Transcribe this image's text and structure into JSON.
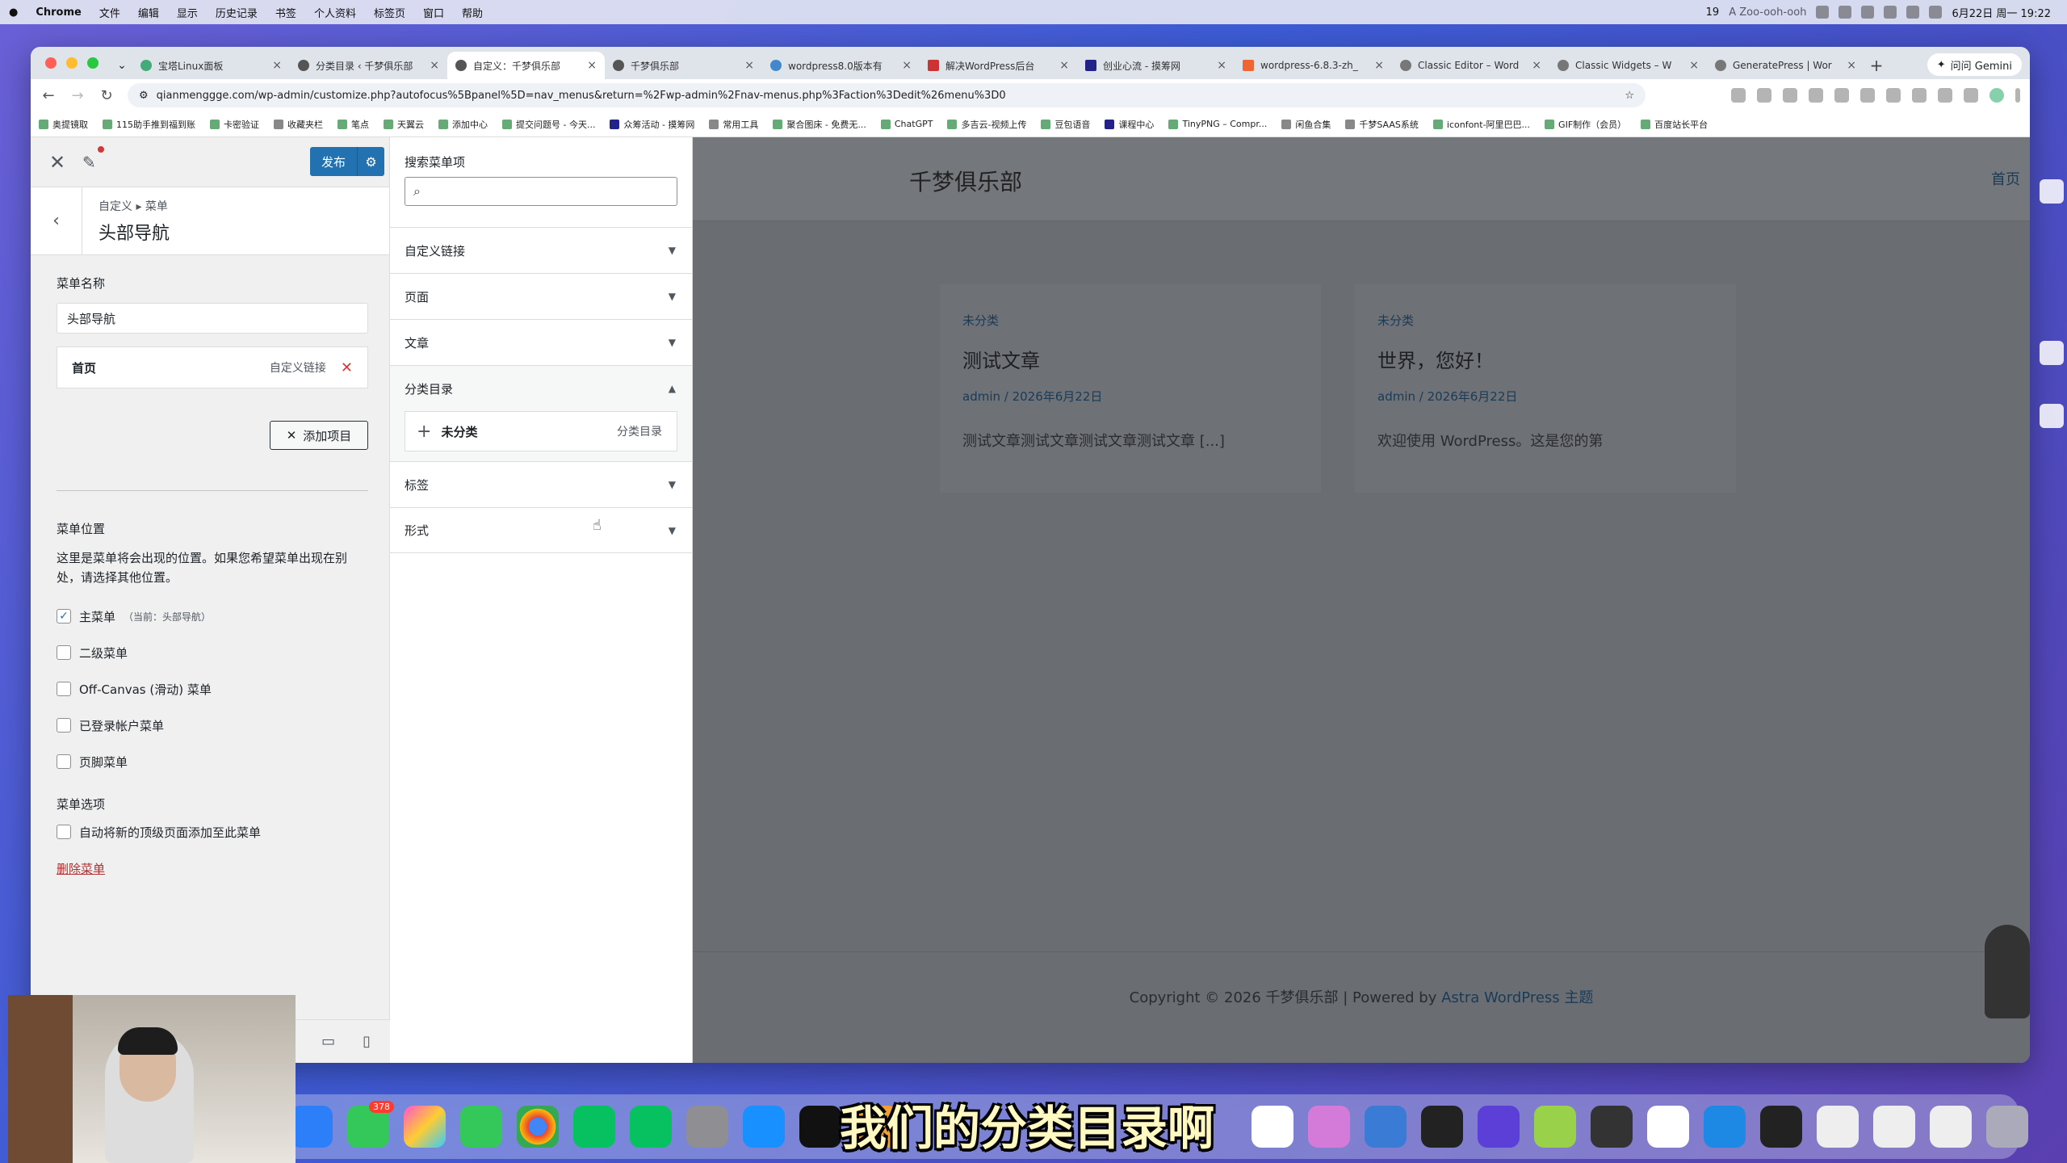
{
  "menubar": {
    "app": "Chrome",
    "items": [
      "文件",
      "编辑",
      "显示",
      "历史记录",
      "书签",
      "个人资料",
      "标签页",
      "窗口",
      "帮助"
    ],
    "status_text": "A Zoo-ooh-ooh",
    "badge_count": "19",
    "clock": "6月22日 周一 19:22"
  },
  "tabs": [
    {
      "title": "宝塔Linux面板"
    },
    {
      "title": "分类目录 ‹ 千梦俱乐部"
    },
    {
      "title": "自定义：千梦俱乐部"
    },
    {
      "title": "千梦俱乐部"
    },
    {
      "title": "wordpress8.0版本有"
    },
    {
      "title": "解决WordPress后台"
    },
    {
      "title": "创业心流 - 摸筹网"
    },
    {
      "title": "wordpress-6.8.3-zh_"
    },
    {
      "title": "Classic Editor – Word"
    },
    {
      "title": "Classic Widgets – W"
    },
    {
      "title": "GeneratePress | Wor"
    }
  ],
  "gemini_label": "问问 Gemini",
  "url": "qianmenggge.com/wp-admin/customize.php?autofocus%5Bpanel%5D=nav_menus&return=%2Fwp-admin%2Fnav-menus.php%3Faction%3Dedit%26menu%3D0",
  "bookmarks": [
    "奥提镜取",
    "115助手推到福到账",
    "卡密验证",
    "收藏夹栏",
    "笔点",
    "天翼云",
    "添加中心",
    "提交问题号 - 今天...",
    "众筹活动 - 摸筹网",
    "常用工具",
    "聚合图床 - 免费无...",
    "ChatGPT",
    "多吉云-视频上传",
    "豆包语音",
    "课程中心",
    "TinyPNG – Compr...",
    "闲鱼合集",
    "千梦SAAS系统",
    "iconfont-阿里巴巴...",
    "GIF制作（会员）",
    "百度站长平台"
  ],
  "customizer": {
    "publish_label": "发布",
    "breadcrumb": "自定义 ▸ 菜单",
    "section_title": "头部导航",
    "menu_name_label": "菜单名称",
    "menu_name_value": "头部导航",
    "items": [
      {
        "title": "首页",
        "type": "自定义链接"
      }
    ],
    "add_items_label": "添加项目",
    "locations_label": "菜单位置",
    "locations_desc": "这里是菜单将会出现的位置。如果您希望菜单出现在别处，请选择其他位置。",
    "locations": [
      {
        "label": "主菜单",
        "checked": true,
        "current": "（当前：头部导航）"
      },
      {
        "label": "二级菜单",
        "checked": false
      },
      {
        "label": "Off-Canvas (滑动) 菜单",
        "checked": false
      },
      {
        "label": "已登录帐户菜单",
        "checked": false
      },
      {
        "label": "页脚菜单",
        "checked": false
      }
    ],
    "options_label": "菜单选项",
    "auto_add_label": "自动将新的顶级页面添加至此菜单",
    "delete_menu_label": "删除菜单"
  },
  "add_items_panel": {
    "search_label": "搜索菜单项",
    "sections": [
      {
        "title": "自定义链接",
        "open": false
      },
      {
        "title": "页面",
        "open": false
      },
      {
        "title": "文章",
        "open": false
      },
      {
        "title": "分类目录",
        "open": true
      },
      {
        "title": "标签",
        "open": false
      },
      {
        "title": "形式",
        "open": false
      }
    ],
    "category_item": {
      "title": "未分类",
      "type": "分类目录"
    }
  },
  "preview": {
    "site_title": "千梦俱乐部",
    "nav_home": "首页",
    "posts": [
      {
        "category": "未分类",
        "title": "测试文章",
        "meta": "admin / 2026年6月22日",
        "excerpt": "测试文章测试文章测试文章测试文章 [...]"
      },
      {
        "category": "未分类",
        "title": "世界，您好！",
        "meta": "admin / 2026年6月22日",
        "excerpt": "欢迎使用 WordPress。这是您的第"
      }
    ],
    "footer_text": "Copyright © 2026 千梦俱乐部 | Powered by ",
    "footer_link": "Astra WordPress 主题"
  },
  "subtitle": "我们的分类目录啊",
  "colors": {
    "primary": "#2271b1",
    "danger": "#d63638",
    "overlay": "#6a6d72"
  },
  "dock_badge": "378"
}
